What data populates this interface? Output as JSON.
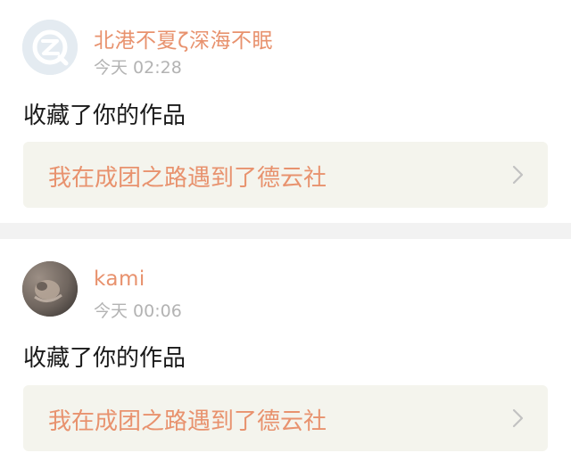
{
  "notifications": [
    {
      "username": "北港不夏ζ深海不眠",
      "time": "今天 02:28",
      "action": "收藏了你的作品",
      "work_title": "我在成团之路遇到了德云社",
      "avatar_icon": "default-q-avatar-icon"
    },
    {
      "username": "kami",
      "time": "今天 00:06",
      "action": "收藏了你的作品",
      "work_title": "我在成团之路遇到了德云社",
      "avatar_icon": "photo-avatar"
    }
  ],
  "colors": {
    "accent": "#e8926e",
    "card_bg": "#f4f4ed",
    "timestamp": "#b3b3b3",
    "divider": "#f2f2f2"
  }
}
